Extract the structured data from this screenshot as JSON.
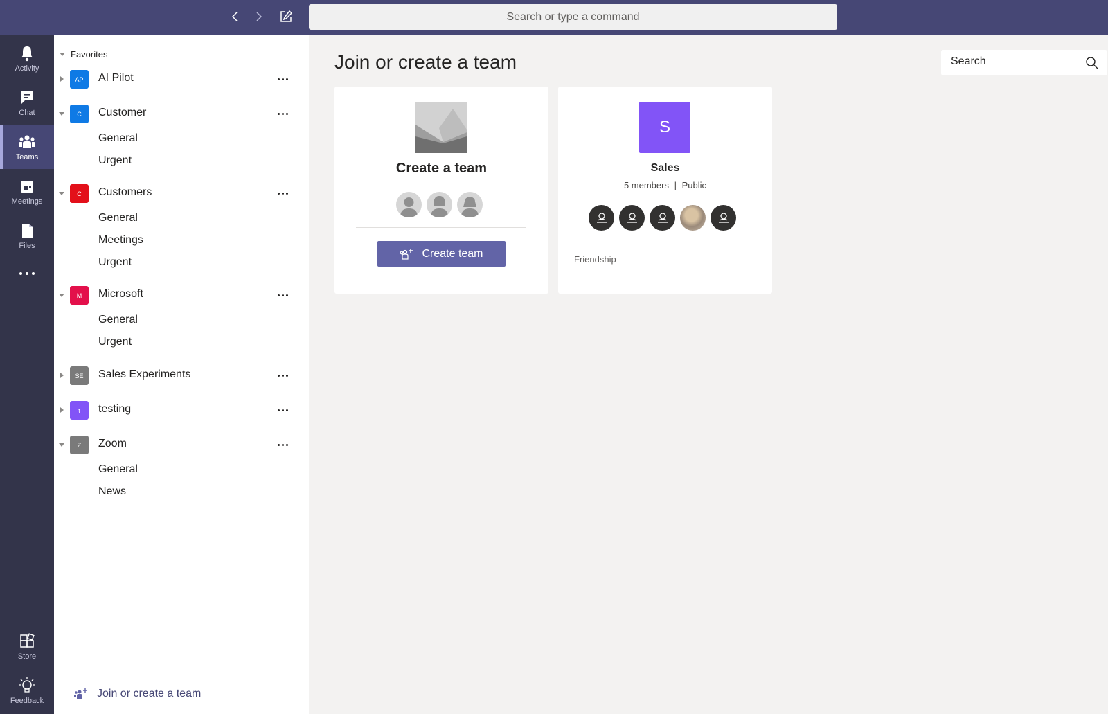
{
  "topbar": {
    "search_placeholder": "Search or type a command",
    "back_icon": "chevron-left-icon",
    "forward_icon": "chevron-right-icon",
    "compose_icon": "compose-icon"
  },
  "rail": {
    "items": [
      {
        "label": "Activity",
        "icon": "bell-icon"
      },
      {
        "label": "Chat",
        "icon": "chat-icon"
      },
      {
        "label": "Teams",
        "icon": "teams-icon",
        "active": true
      },
      {
        "label": "Meetings",
        "icon": "calendar-icon"
      },
      {
        "label": "Files",
        "icon": "file-icon"
      }
    ],
    "more_icon": "ellipsis-icon",
    "bottom": [
      {
        "label": "Store",
        "icon": "store-icon"
      },
      {
        "label": "Feedback",
        "icon": "lightbulb-icon"
      }
    ]
  },
  "panel": {
    "favorites_label": "Favorites",
    "teams": [
      {
        "initials": "AP",
        "name": "AI Pilot",
        "color": "#0f7ae5",
        "expanded": false,
        "channels": []
      },
      {
        "initials": "C",
        "name": "Customer",
        "color": "#0f7ae5",
        "expanded": true,
        "channels": [
          "General",
          "Urgent"
        ]
      },
      {
        "initials": "C",
        "name": "Customers",
        "color": "#e3101a",
        "expanded": true,
        "channels": [
          "General",
          "Meetings",
          "Urgent"
        ]
      },
      {
        "initials": "M",
        "name": "Microsoft",
        "color": "#e3104b",
        "expanded": true,
        "channels": [
          "General",
          "Urgent"
        ]
      },
      {
        "initials": "SE",
        "name": "Sales Experiments",
        "color": "#7a7a7a",
        "expanded": false,
        "channels": []
      },
      {
        "initials": "t",
        "name": "testing",
        "color": "#8254f7",
        "expanded": false,
        "channels": []
      },
      {
        "initials": "Z",
        "name": "Zoom",
        "color": "#7a7a7a",
        "expanded": true,
        "channels": [
          "General",
          "News"
        ]
      }
    ],
    "join_label": "Join or create a team"
  },
  "main": {
    "title": "Join or create a team",
    "search_placeholder": "Search",
    "create_card": {
      "title": "Create a team",
      "button_label": "Create team"
    },
    "sales_card": {
      "initial": "S",
      "name": "Sales",
      "members": "5 members",
      "separator": "|",
      "visibility": "Public",
      "tag": "Friendship",
      "tile_color": "#8254f7"
    }
  },
  "colors": {
    "accent": "#6264a7",
    "topbar": "#464775",
    "rail": "#33344a"
  }
}
